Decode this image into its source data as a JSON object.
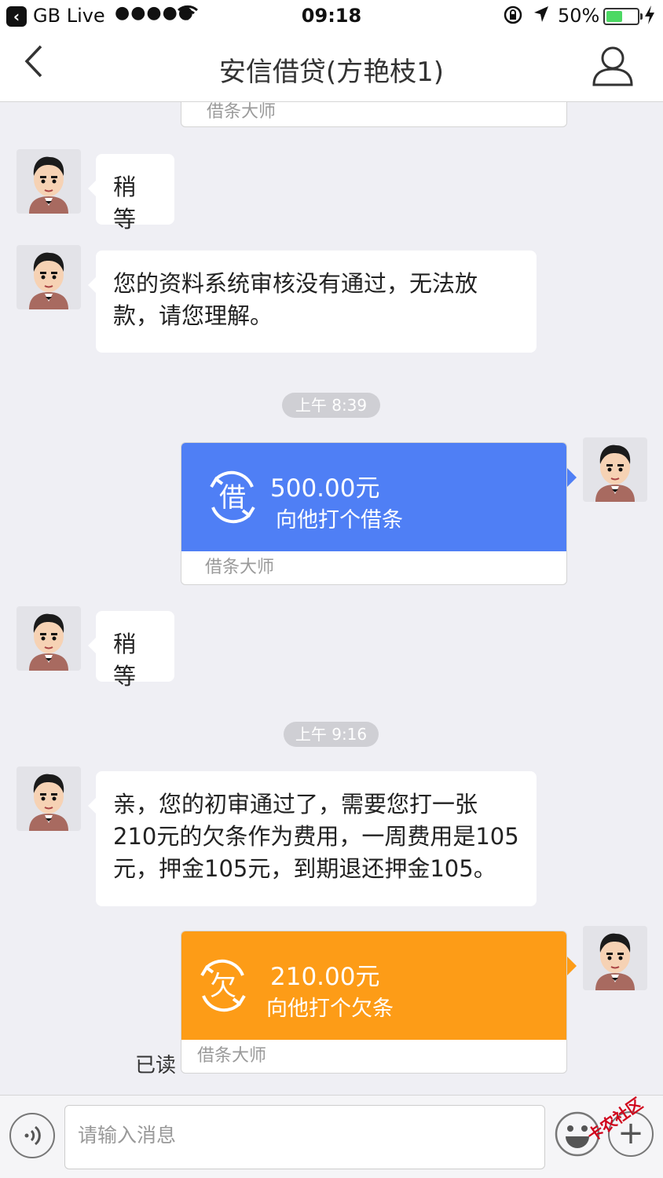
{
  "status_bar": {
    "carrier": "GB Live",
    "signal": "●●●●●",
    "time": "09:18",
    "battery": "50%"
  },
  "nav": {
    "title": "安信借贷(方艳枝1)"
  },
  "cards": {
    "top_stub_footer": "借条大师",
    "loan": {
      "amount": "500.00元",
      "subtitle": "向他打个借条",
      "footer": "借条大师",
      "icon_char": "借"
    },
    "debt": {
      "amount": "210.00元",
      "subtitle": "向他打个欠条",
      "footer": "借条大师",
      "icon_char": "欠"
    }
  },
  "messages": {
    "m1": "稍等",
    "m2": "您的资料系统审核没有通过，无法放款，请您理解。",
    "m3": "稍等",
    "m4": "亲，您的初审通过了，需要您打一张210元的欠条作为费用，一周费用是105元，押金105元，到期退还押金105。"
  },
  "timestamps": {
    "t1": "上午 8:39",
    "t2": "上午 9:16"
  },
  "read_status": "已读",
  "input": {
    "placeholder": "请输入消息"
  },
  "watermark": "卡农社区",
  "colors": {
    "loan_card": "#4f7ff5",
    "debt_card": "#fd9c17",
    "background": "#efeff4"
  }
}
